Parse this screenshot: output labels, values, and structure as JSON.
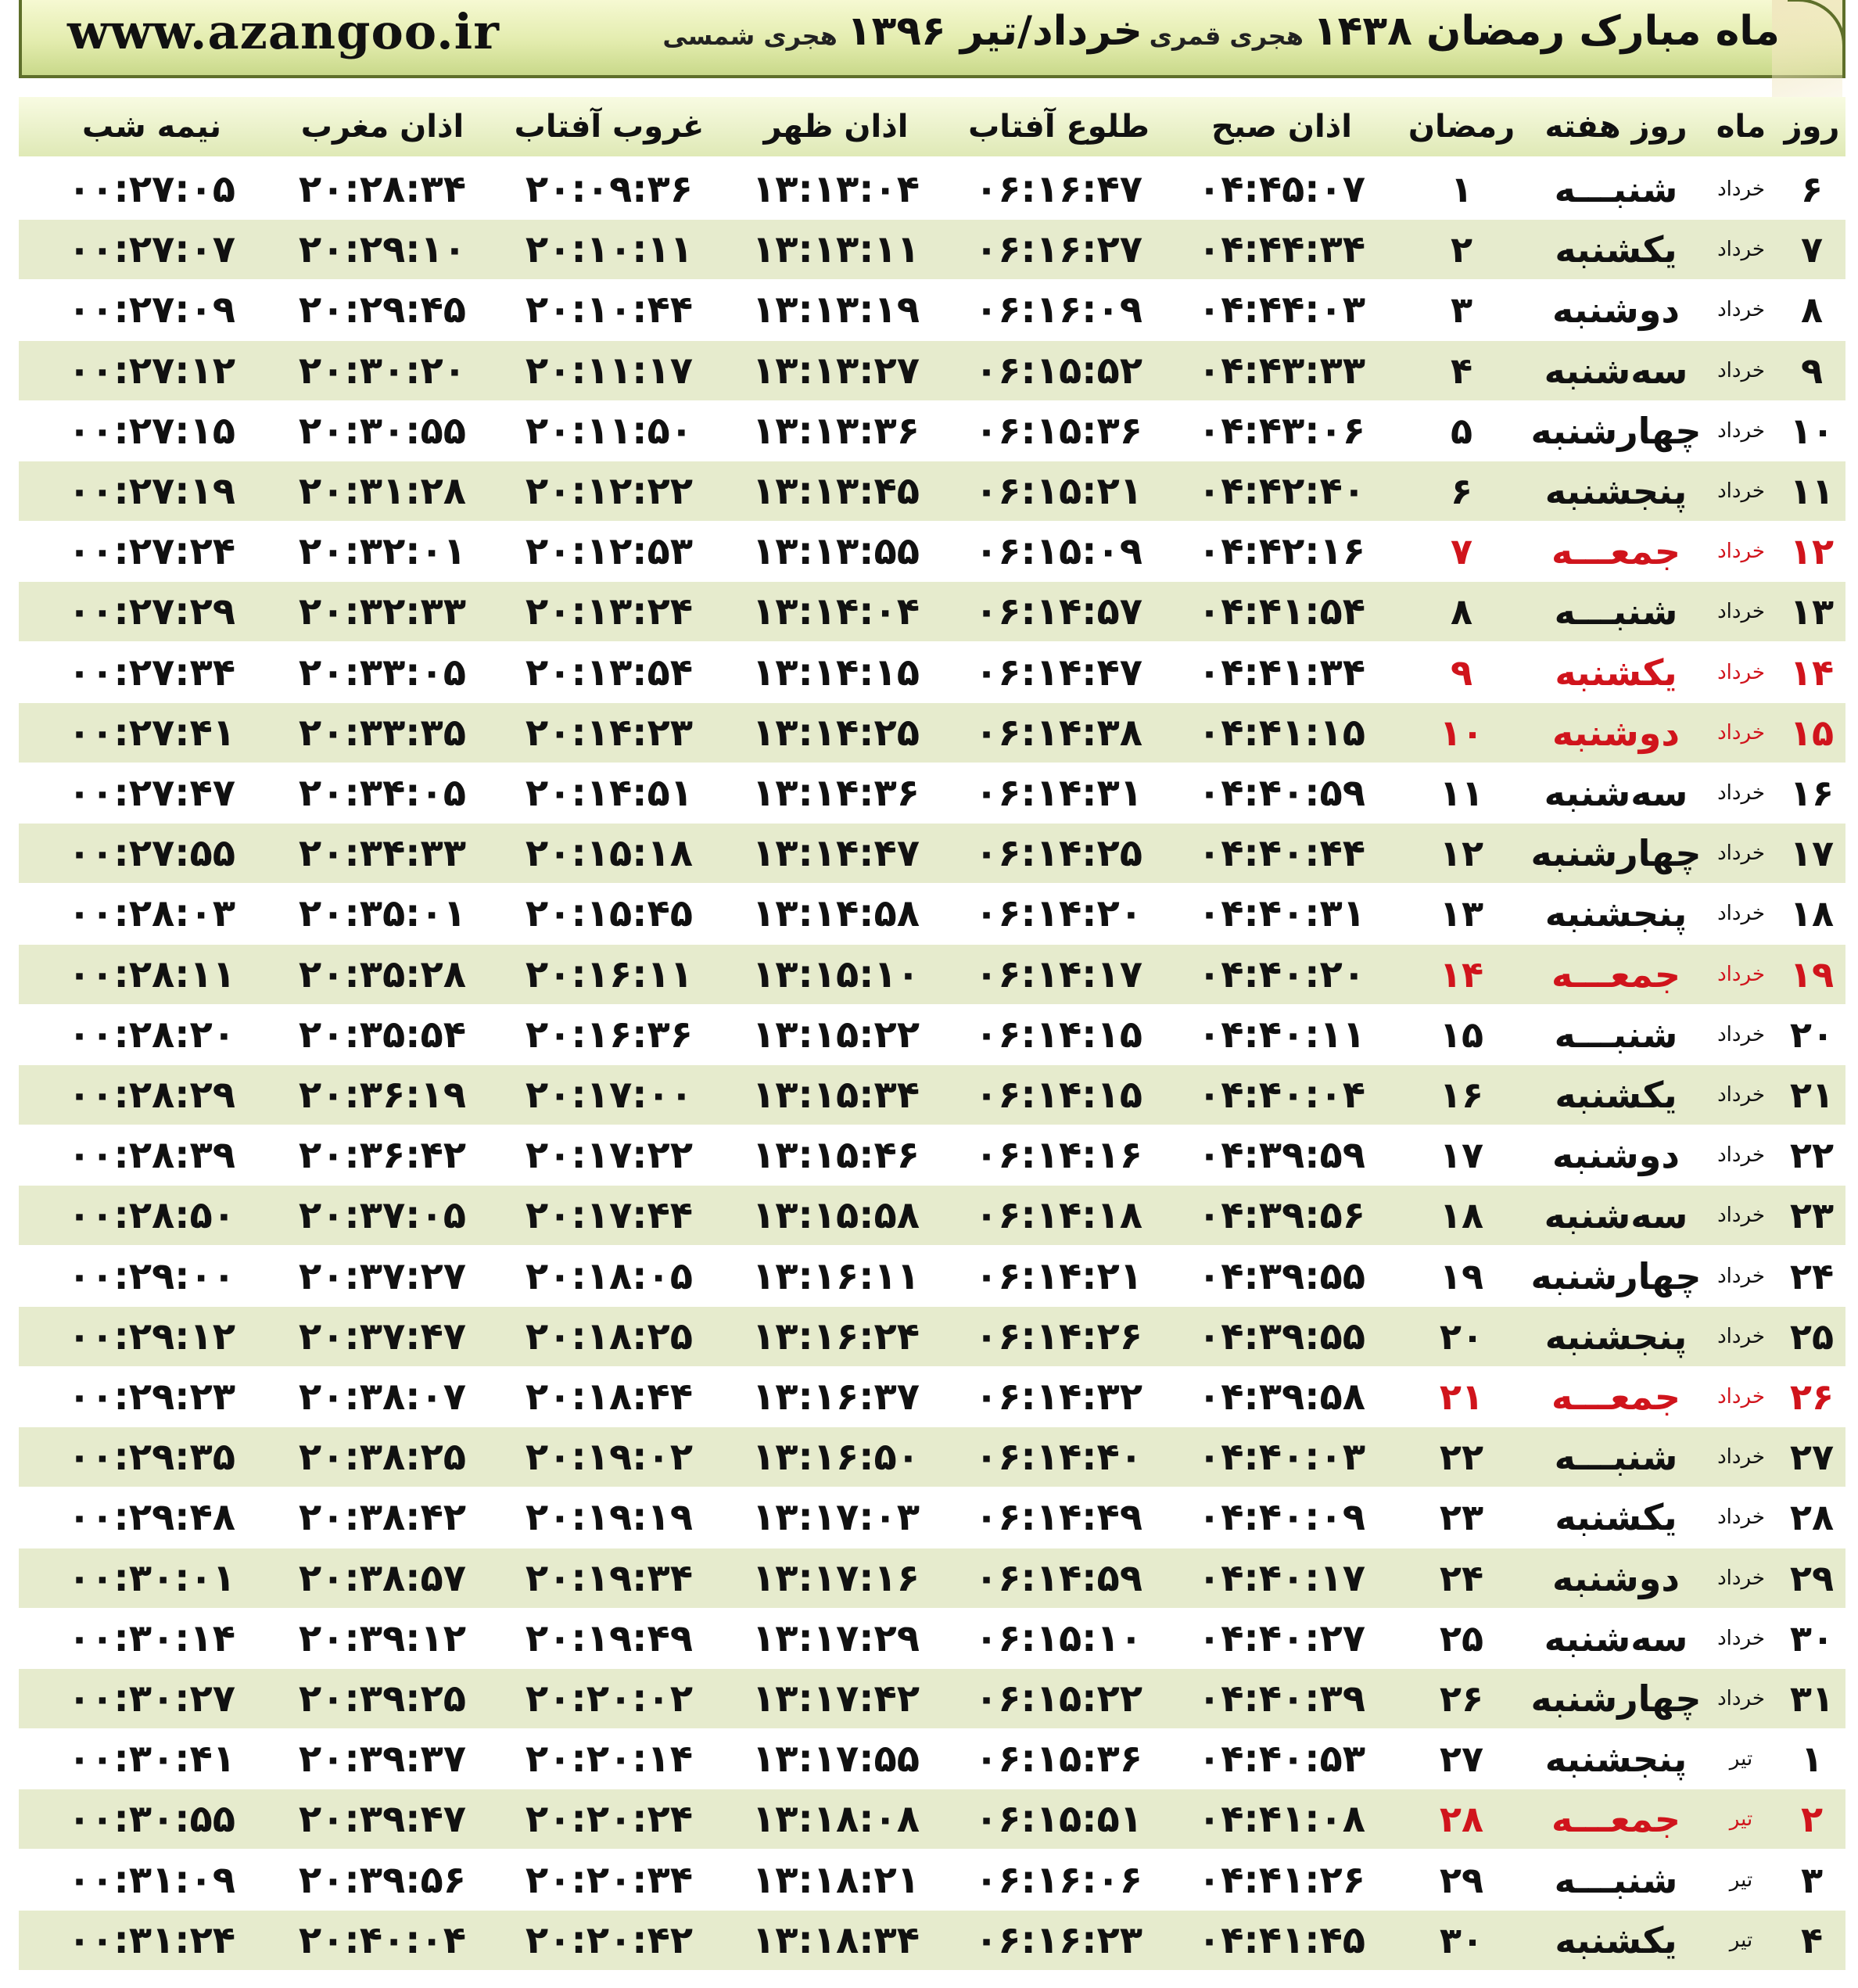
{
  "banner": {
    "site": "www.azangoo.ir",
    "hijri_title": "ماه مبارک رمضان ۱۴۳۸",
    "hijri_label": "هجری قمری",
    "shamsi_title": "خرداد/تیر ۱۳۹۶",
    "shamsi_label": "هجری شمسی"
  },
  "columns": [
    "روز",
    "ماه",
    "روز هفته",
    "رمضان",
    "اذان صبح",
    "طلوع آفتاب",
    "اذان ظهر",
    "غروب آفتاب",
    "اذان مغرب",
    "نیمه شب"
  ],
  "highlight_color": "#d0141c",
  "rows": [
    {
      "day": "۶",
      "month": "خرداد",
      "weekday": "شنبـــه",
      "ramadan": "۱",
      "fajr": "۰۴:۴۵:۰۷",
      "sunrise": "۰۶:۱۶:۴۷",
      "dhuhr": "۱۳:۱۳:۰۴",
      "sunset": "۲۰:۰۹:۳۶",
      "maghrib": "۲۰:۲۸:۳۴",
      "midnight": "۰۰:۲۷:۰۵",
      "holiday": false
    },
    {
      "day": "۷",
      "month": "خرداد",
      "weekday": "یکشنبه",
      "ramadan": "۲",
      "fajr": "۰۴:۴۴:۳۴",
      "sunrise": "۰۶:۱۶:۲۷",
      "dhuhr": "۱۳:۱۳:۱۱",
      "sunset": "۲۰:۱۰:۱۱",
      "maghrib": "۲۰:۲۹:۱۰",
      "midnight": "۰۰:۲۷:۰۷",
      "holiday": false
    },
    {
      "day": "۸",
      "month": "خرداد",
      "weekday": "دوشنبه",
      "ramadan": "۳",
      "fajr": "۰۴:۴۴:۰۳",
      "sunrise": "۰۶:۱۶:۰۹",
      "dhuhr": "۱۳:۱۳:۱۹",
      "sunset": "۲۰:۱۰:۴۴",
      "maghrib": "۲۰:۲۹:۴۵",
      "midnight": "۰۰:۲۷:۰۹",
      "holiday": false
    },
    {
      "day": "۹",
      "month": "خرداد",
      "weekday": "سه‌شنبه",
      "ramadan": "۴",
      "fajr": "۰۴:۴۳:۳۳",
      "sunrise": "۰۶:۱۵:۵۲",
      "dhuhr": "۱۳:۱۳:۲۷",
      "sunset": "۲۰:۱۱:۱۷",
      "maghrib": "۲۰:۳۰:۲۰",
      "midnight": "۰۰:۲۷:۱۲",
      "holiday": false
    },
    {
      "day": "۱۰",
      "month": "خرداد",
      "weekday": "چهارشنبه",
      "ramadan": "۵",
      "fajr": "۰۴:۴۳:۰۶",
      "sunrise": "۰۶:۱۵:۳۶",
      "dhuhr": "۱۳:۱۳:۳۶",
      "sunset": "۲۰:۱۱:۵۰",
      "maghrib": "۲۰:۳۰:۵۵",
      "midnight": "۰۰:۲۷:۱۵",
      "holiday": false
    },
    {
      "day": "۱۱",
      "month": "خرداد",
      "weekday": "پنجشنبه",
      "ramadan": "۶",
      "fajr": "۰۴:۴۲:۴۰",
      "sunrise": "۰۶:۱۵:۲۱",
      "dhuhr": "۱۳:۱۳:۴۵",
      "sunset": "۲۰:۱۲:۲۲",
      "maghrib": "۲۰:۳۱:۲۸",
      "midnight": "۰۰:۲۷:۱۹",
      "holiday": false
    },
    {
      "day": "۱۲",
      "month": "خرداد",
      "weekday": "جمعـــه",
      "ramadan": "۷",
      "fajr": "۰۴:۴۲:۱۶",
      "sunrise": "۰۶:۱۵:۰۹",
      "dhuhr": "۱۳:۱۳:۵۵",
      "sunset": "۲۰:۱۲:۵۳",
      "maghrib": "۲۰:۳۲:۰۱",
      "midnight": "۰۰:۲۷:۲۴",
      "holiday": true
    },
    {
      "day": "۱۳",
      "month": "خرداد",
      "weekday": "شنبـــه",
      "ramadan": "۸",
      "fajr": "۰۴:۴۱:۵۴",
      "sunrise": "۰۶:۱۴:۵۷",
      "dhuhr": "۱۳:۱۴:۰۴",
      "sunset": "۲۰:۱۳:۲۴",
      "maghrib": "۲۰:۳۲:۳۳",
      "midnight": "۰۰:۲۷:۲۹",
      "holiday": false
    },
    {
      "day": "۱۴",
      "month": "خرداد",
      "weekday": "یکشنبه",
      "ramadan": "۹",
      "fajr": "۰۴:۴۱:۳۴",
      "sunrise": "۰۶:۱۴:۴۷",
      "dhuhr": "۱۳:۱۴:۱۵",
      "sunset": "۲۰:۱۳:۵۴",
      "maghrib": "۲۰:۳۳:۰۵",
      "midnight": "۰۰:۲۷:۳۴",
      "holiday": true
    },
    {
      "day": "۱۵",
      "month": "خرداد",
      "weekday": "دوشنبه",
      "ramadan": "۱۰",
      "fajr": "۰۴:۴۱:۱۵",
      "sunrise": "۰۶:۱۴:۳۸",
      "dhuhr": "۱۳:۱۴:۲۵",
      "sunset": "۲۰:۱۴:۲۳",
      "maghrib": "۲۰:۳۳:۳۵",
      "midnight": "۰۰:۲۷:۴۱",
      "holiday": true
    },
    {
      "day": "۱۶",
      "month": "خرداد",
      "weekday": "سه‌شنبه",
      "ramadan": "۱۱",
      "fajr": "۰۴:۴۰:۵۹",
      "sunrise": "۰۶:۱۴:۳۱",
      "dhuhr": "۱۳:۱۴:۳۶",
      "sunset": "۲۰:۱۴:۵۱",
      "maghrib": "۲۰:۳۴:۰۵",
      "midnight": "۰۰:۲۷:۴۷",
      "holiday": false
    },
    {
      "day": "۱۷",
      "month": "خرداد",
      "weekday": "چهارشنبه",
      "ramadan": "۱۲",
      "fajr": "۰۴:۴۰:۴۴",
      "sunrise": "۰۶:۱۴:۲۵",
      "dhuhr": "۱۳:۱۴:۴۷",
      "sunset": "۲۰:۱۵:۱۸",
      "maghrib": "۲۰:۳۴:۳۳",
      "midnight": "۰۰:۲۷:۵۵",
      "holiday": false
    },
    {
      "day": "۱۸",
      "month": "خرداد",
      "weekday": "پنجشنبه",
      "ramadan": "۱۳",
      "fajr": "۰۴:۴۰:۳۱",
      "sunrise": "۰۶:۱۴:۲۰",
      "dhuhr": "۱۳:۱۴:۵۸",
      "sunset": "۲۰:۱۵:۴۵",
      "maghrib": "۲۰:۳۵:۰۱",
      "midnight": "۰۰:۲۸:۰۳",
      "holiday": false
    },
    {
      "day": "۱۹",
      "month": "خرداد",
      "weekday": "جمعـــه",
      "ramadan": "۱۴",
      "fajr": "۰۴:۴۰:۲۰",
      "sunrise": "۰۶:۱۴:۱۷",
      "dhuhr": "۱۳:۱۵:۱۰",
      "sunset": "۲۰:۱۶:۱۱",
      "maghrib": "۲۰:۳۵:۲۸",
      "midnight": "۰۰:۲۸:۱۱",
      "holiday": true
    },
    {
      "day": "۲۰",
      "month": "خرداد",
      "weekday": "شنبـــه",
      "ramadan": "۱۵",
      "fajr": "۰۴:۴۰:۱۱",
      "sunrise": "۰۶:۱۴:۱۵",
      "dhuhr": "۱۳:۱۵:۲۲",
      "sunset": "۲۰:۱۶:۳۶",
      "maghrib": "۲۰:۳۵:۵۴",
      "midnight": "۰۰:۲۸:۲۰",
      "holiday": false
    },
    {
      "day": "۲۱",
      "month": "خرداد",
      "weekday": "یکشنبه",
      "ramadan": "۱۶",
      "fajr": "۰۴:۴۰:۰۴",
      "sunrise": "۰۶:۱۴:۱۵",
      "dhuhr": "۱۳:۱۵:۳۴",
      "sunset": "۲۰:۱۷:۰۰",
      "maghrib": "۲۰:۳۶:۱۹",
      "midnight": "۰۰:۲۸:۲۹",
      "holiday": false
    },
    {
      "day": "۲۲",
      "month": "خرداد",
      "weekday": "دوشنبه",
      "ramadan": "۱۷",
      "fajr": "۰۴:۳۹:۵۹",
      "sunrise": "۰۶:۱۴:۱۶",
      "dhuhr": "۱۳:۱۵:۴۶",
      "sunset": "۲۰:۱۷:۲۲",
      "maghrib": "۲۰:۳۶:۴۲",
      "midnight": "۰۰:۲۸:۳۹",
      "holiday": false
    },
    {
      "day": "۲۳",
      "month": "خرداد",
      "weekday": "سه‌شنبه",
      "ramadan": "۱۸",
      "fajr": "۰۴:۳۹:۵۶",
      "sunrise": "۰۶:۱۴:۱۸",
      "dhuhr": "۱۳:۱۵:۵۸",
      "sunset": "۲۰:۱۷:۴۴",
      "maghrib": "۲۰:۳۷:۰۵",
      "midnight": "۰۰:۲۸:۵۰",
      "holiday": false
    },
    {
      "day": "۲۴",
      "month": "خرداد",
      "weekday": "چهارشنبه",
      "ramadan": "۱۹",
      "fajr": "۰۴:۳۹:۵۵",
      "sunrise": "۰۶:۱۴:۲۱",
      "dhuhr": "۱۳:۱۶:۱۱",
      "sunset": "۲۰:۱۸:۰۵",
      "maghrib": "۲۰:۳۷:۲۷",
      "midnight": "۰۰:۲۹:۰۰",
      "holiday": false
    },
    {
      "day": "۲۵",
      "month": "خرداد",
      "weekday": "پنجشنبه",
      "ramadan": "۲۰",
      "fajr": "۰۴:۳۹:۵۵",
      "sunrise": "۰۶:۱۴:۲۶",
      "dhuhr": "۱۳:۱۶:۲۴",
      "sunset": "۲۰:۱۸:۲۵",
      "maghrib": "۲۰:۳۷:۴۷",
      "midnight": "۰۰:۲۹:۱۲",
      "holiday": false
    },
    {
      "day": "۲۶",
      "month": "خرداد",
      "weekday": "جمعـــه",
      "ramadan": "۲۱",
      "fajr": "۰۴:۳۹:۵۸",
      "sunrise": "۰۶:۱۴:۳۲",
      "dhuhr": "۱۳:۱۶:۳۷",
      "sunset": "۲۰:۱۸:۴۴",
      "maghrib": "۲۰:۳۸:۰۷",
      "midnight": "۰۰:۲۹:۲۳",
      "holiday": true
    },
    {
      "day": "۲۷",
      "month": "خرداد",
      "weekday": "شنبـــه",
      "ramadan": "۲۲",
      "fajr": "۰۴:۴۰:۰۳",
      "sunrise": "۰۶:۱۴:۴۰",
      "dhuhr": "۱۳:۱۶:۵۰",
      "sunset": "۲۰:۱۹:۰۲",
      "maghrib": "۲۰:۳۸:۲۵",
      "midnight": "۰۰:۲۹:۳۵",
      "holiday": false
    },
    {
      "day": "۲۸",
      "month": "خرداد",
      "weekday": "یکشنبه",
      "ramadan": "۲۳",
      "fajr": "۰۴:۴۰:۰۹",
      "sunrise": "۰۶:۱۴:۴۹",
      "dhuhr": "۱۳:۱۷:۰۳",
      "sunset": "۲۰:۱۹:۱۹",
      "maghrib": "۲۰:۳۸:۴۲",
      "midnight": "۰۰:۲۹:۴۸",
      "holiday": false
    },
    {
      "day": "۲۹",
      "month": "خرداد",
      "weekday": "دوشنبه",
      "ramadan": "۲۴",
      "fajr": "۰۴:۴۰:۱۷",
      "sunrise": "۰۶:۱۴:۵۹",
      "dhuhr": "۱۳:۱۷:۱۶",
      "sunset": "۲۰:۱۹:۳۴",
      "maghrib": "۲۰:۳۸:۵۷",
      "midnight": "۰۰:۳۰:۰۱",
      "holiday": false
    },
    {
      "day": "۳۰",
      "month": "خرداد",
      "weekday": "سه‌شنبه",
      "ramadan": "۲۵",
      "fajr": "۰۴:۴۰:۲۷",
      "sunrise": "۰۶:۱۵:۱۰",
      "dhuhr": "۱۳:۱۷:۲۹",
      "sunset": "۲۰:۱۹:۴۹",
      "maghrib": "۲۰:۳۹:۱۲",
      "midnight": "۰۰:۳۰:۱۴",
      "holiday": false
    },
    {
      "day": "۳۱",
      "month": "خرداد",
      "weekday": "چهارشنبه",
      "ramadan": "۲۶",
      "fajr": "۰۴:۴۰:۳۹",
      "sunrise": "۰۶:۱۵:۲۲",
      "dhuhr": "۱۳:۱۷:۴۲",
      "sunset": "۲۰:۲۰:۰۲",
      "maghrib": "۲۰:۳۹:۲۵",
      "midnight": "۰۰:۳۰:۲۷",
      "holiday": false
    },
    {
      "day": "۱",
      "month": "تیر",
      "weekday": "پنجشنبه",
      "ramadan": "۲۷",
      "fajr": "۰۴:۴۰:۵۳",
      "sunrise": "۰۶:۱۵:۳۶",
      "dhuhr": "۱۳:۱۷:۵۵",
      "sunset": "۲۰:۲۰:۱۴",
      "maghrib": "۲۰:۳۹:۳۷",
      "midnight": "۰۰:۳۰:۴۱",
      "holiday": false
    },
    {
      "day": "۲",
      "month": "تیر",
      "weekday": "جمعـــه",
      "ramadan": "۲۸",
      "fajr": "۰۴:۴۱:۰۸",
      "sunrise": "۰۶:۱۵:۵۱",
      "dhuhr": "۱۳:۱۸:۰۸",
      "sunset": "۲۰:۲۰:۲۴",
      "maghrib": "۲۰:۳۹:۴۷",
      "midnight": "۰۰:۳۰:۵۵",
      "holiday": true
    },
    {
      "day": "۳",
      "month": "تیر",
      "weekday": "شنبـــه",
      "ramadan": "۲۹",
      "fajr": "۰۴:۴۱:۲۶",
      "sunrise": "۰۶:۱۶:۰۶",
      "dhuhr": "۱۳:۱۸:۲۱",
      "sunset": "۲۰:۲۰:۳۴",
      "maghrib": "۲۰:۳۹:۵۶",
      "midnight": "۰۰:۳۱:۰۹",
      "holiday": false
    },
    {
      "day": "۴",
      "month": "تیر",
      "weekday": "یکشنبه",
      "ramadan": "۳۰",
      "fajr": "۰۴:۴۱:۴۵",
      "sunrise": "۰۶:۱۶:۲۳",
      "dhuhr": "۱۳:۱۸:۳۴",
      "sunset": "۲۰:۲۰:۴۲",
      "maghrib": "۲۰:۴۰:۰۴",
      "midnight": "۰۰:۳۱:۲۴",
      "holiday": false
    }
  ]
}
